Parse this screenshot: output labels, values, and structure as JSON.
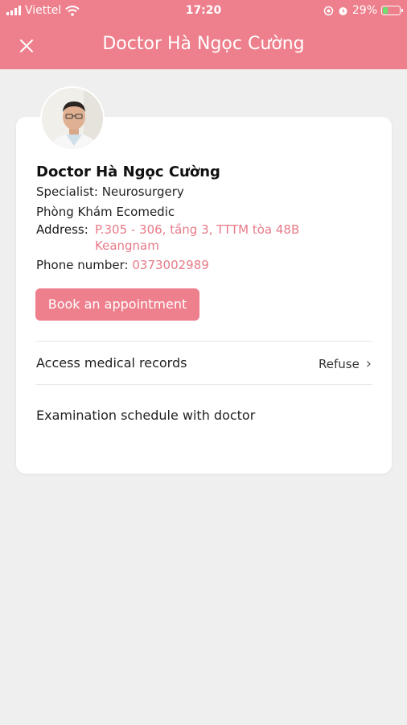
{
  "status_bar": {
    "carrier": "Viettel",
    "time": "17:20",
    "battery_percent": "29%",
    "battery_level": 0.29
  },
  "header": {
    "close_icon": "close-icon",
    "title": "Doctor Hà Ngọc Cường"
  },
  "doctor": {
    "name": "Doctor Hà Ngọc Cường",
    "specialist_label": "Specialist:",
    "specialist": "Neurosurgery",
    "clinic": "Phòng Khám Ecomedic",
    "address_label": "Address:",
    "address": "P.305 - 306, tầng 3, TTTM tòa 48B Keangnam",
    "phone_label": "Phone number:",
    "phone": "0373002989"
  },
  "actions": {
    "book_label": "Book an appointment"
  },
  "rows": {
    "medical_records_label": "Access medical records",
    "medical_records_value": "Refuse",
    "schedule_label": "Examination schedule with doctor"
  },
  "colors": {
    "accent": "#ee7f8c",
    "link": "#e77b88",
    "background": "#efeff0"
  }
}
